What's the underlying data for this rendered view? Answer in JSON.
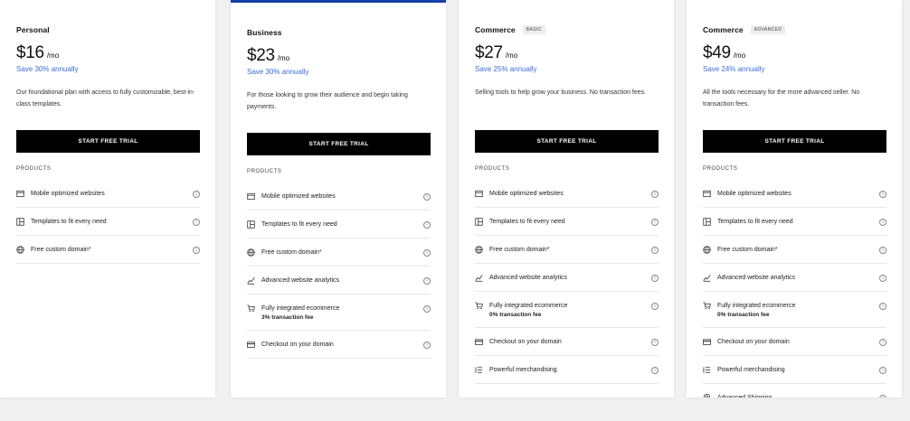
{
  "plans": [
    {
      "name": "Personal",
      "badge": "",
      "price": "$16",
      "per": "/mo",
      "save": "Save 30% annually",
      "description": "Our foundational plan with access to fully customizable, best-in-class templates.",
      "cta": "START FREE TRIAL",
      "products_label": "PRODUCTS",
      "features": [
        {
          "label": "Mobile optimized websites",
          "sub": "",
          "icon": "browser-icon"
        },
        {
          "label": "Templates to fit every need",
          "sub": "",
          "icon": "template-icon"
        },
        {
          "label": "Free custom domain*",
          "sub": "",
          "icon": "globe-icon"
        }
      ]
    },
    {
      "name": "Business",
      "badge": "",
      "price": "$23",
      "per": "/mo",
      "save": "Save 30% annually",
      "description": "For those looking to grow their audience and begin taking payments.",
      "cta": "START FREE TRIAL",
      "products_label": "PRODUCTS",
      "features": [
        {
          "label": "Mobile optimized websites",
          "sub": "",
          "icon": "browser-icon"
        },
        {
          "label": "Templates to fit every need",
          "sub": "",
          "icon": "template-icon"
        },
        {
          "label": "Free custom domain*",
          "sub": "",
          "icon": "globe-icon"
        },
        {
          "label": "Advanced website analytics",
          "sub": "",
          "icon": "analytics-icon"
        },
        {
          "label": "Fully integrated ecommerce",
          "sub": "3% transaction fee",
          "icon": "cart-icon"
        },
        {
          "label": "Checkout on your domain",
          "sub": "",
          "icon": "card-icon"
        }
      ]
    },
    {
      "name": "Commerce",
      "badge": "BASIC",
      "price": "$27",
      "per": "/mo",
      "save": "Save 25% annually",
      "description": "Selling tools to help grow your business. No transaction fees.",
      "cta": "START FREE TRIAL",
      "products_label": "PRODUCTS",
      "features": [
        {
          "label": "Mobile optimized websites",
          "sub": "",
          "icon": "browser-icon"
        },
        {
          "label": "Templates to fit every need",
          "sub": "",
          "icon": "template-icon"
        },
        {
          "label": "Free custom domain*",
          "sub": "",
          "icon": "globe-icon"
        },
        {
          "label": "Advanced website analytics",
          "sub": "",
          "icon": "analytics-icon"
        },
        {
          "label": "Fully integrated ecommerce",
          "sub": "0% transaction fee",
          "icon": "cart-icon"
        },
        {
          "label": "Checkout on your domain",
          "sub": "",
          "icon": "card-icon"
        },
        {
          "label": "Powerful merchandising",
          "sub": "",
          "icon": "list-icon"
        }
      ]
    },
    {
      "name": "Commerce",
      "badge": "ADVANCED",
      "price": "$49",
      "per": "/mo",
      "save": "Save 24% annually",
      "description": "All the tools necessary for the more advanced seller. No transaction fees.",
      "cta": "START FREE TRIAL",
      "products_label": "PRODUCTS",
      "features": [
        {
          "label": "Mobile optimized websites",
          "sub": "",
          "icon": "browser-icon"
        },
        {
          "label": "Templates to fit every need",
          "sub": "",
          "icon": "template-icon"
        },
        {
          "label": "Free custom domain*",
          "sub": "",
          "icon": "globe-icon"
        },
        {
          "label": "Advanced website analytics",
          "sub": "",
          "icon": "analytics-icon"
        },
        {
          "label": "Fully integrated ecommerce",
          "sub": "0% transaction fee",
          "icon": "cart-icon"
        },
        {
          "label": "Checkout on your domain",
          "sub": "",
          "icon": "card-icon"
        },
        {
          "label": "Powerful merchandising",
          "sub": "",
          "icon": "list-icon"
        },
        {
          "label": "Advanced Shipping",
          "sub": "",
          "icon": "location-pin-icon"
        }
      ]
    }
  ],
  "info_glyph": "i",
  "colors": {
    "accent": "#3d6bd6",
    "highlight_border": "#1640a8",
    "cta_bg": "#000000"
  }
}
